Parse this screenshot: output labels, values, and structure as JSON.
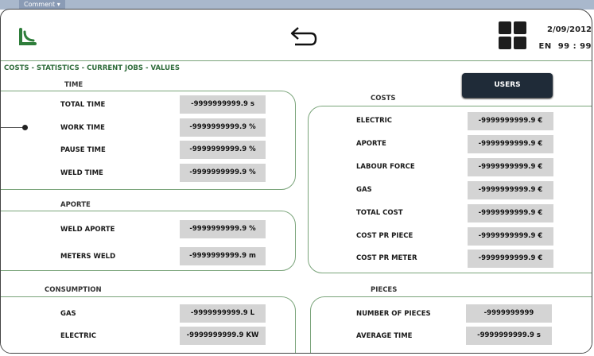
{
  "window": {
    "tab": "Comment"
  },
  "header": {
    "date": "2/09/2012",
    "lang": "EN",
    "time": "99 : 99",
    "brand_color": "#2e7d3a"
  },
  "breadcrumb": "COSTS - STATISTICS - CURRENT JOBS - VALUES",
  "users_button": "USERS",
  "time_section": {
    "title": "TIME",
    "rows": [
      {
        "label": "TOTAL TIME",
        "value": "-9999999999.9 s"
      },
      {
        "label": "WORK TIME",
        "value": "-9999999999.9 %"
      },
      {
        "label": "PAUSE TIME",
        "value": "-9999999999.9 %"
      },
      {
        "label": "WELD TIME",
        "value": "-9999999999.9 %"
      }
    ]
  },
  "aporte_section": {
    "title": "APORTE",
    "rows": [
      {
        "label": "WELD APORTE",
        "value": "-9999999999.9 %"
      },
      {
        "label": "METERS WELD",
        "value": "-9999999999.9 m"
      }
    ]
  },
  "consumption_section": {
    "title": "CONSUMPTION",
    "rows": [
      {
        "label": "GAS",
        "value": "-9999999999.9 L"
      },
      {
        "label": "ELECTRIC",
        "value": "-9999999999.9 KW"
      }
    ]
  },
  "costs_section": {
    "title": "COSTS",
    "rows": [
      {
        "label": "ELECTRIC",
        "value": "-9999999999.9 €"
      },
      {
        "label": "APORTE",
        "value": "-9999999999.9 €"
      },
      {
        "label": "LABOUR FORCE",
        "value": "-9999999999.9 €"
      },
      {
        "label": "GAS",
        "value": "-9999999999.9 €"
      },
      {
        "label": "TOTAL COST",
        "value": "-9999999999.9 €"
      },
      {
        "label": "COST PR PIECE",
        "value": "-9999999999.9 €"
      },
      {
        "label": "COST PR METER",
        "value": "-9999999999.9 €"
      }
    ]
  },
  "pieces_section": {
    "title": "PIECES",
    "rows": [
      {
        "label": "NUMBER OF PIECES",
        "value": "-9999999999"
      },
      {
        "label": "AVERAGE TIME",
        "value": "-9999999999.9 s"
      }
    ]
  }
}
